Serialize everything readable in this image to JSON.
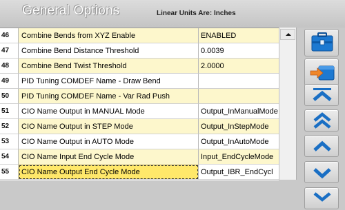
{
  "header": {
    "title": "General Options",
    "units_label": "Linear Units Are: Inches"
  },
  "rows": [
    {
      "num": "46",
      "name": "Combine Bends from XYZ Enable",
      "value": "ENABLED"
    },
    {
      "num": "47",
      "name": "Combine Bend Distance Threshold",
      "value": "0.0039"
    },
    {
      "num": "48",
      "name": "Combine Bend Twist Threshold",
      "value": "2.0000"
    },
    {
      "num": "49",
      "name": "PID Tuning COMDEF Name - Draw Bend",
      "value": ""
    },
    {
      "num": "50",
      "name": "PID Tuning COMDEF Name - Var Rad Push",
      "value": ""
    },
    {
      "num": "51",
      "name": "CIO Name Output in MANUAL Mode",
      "value": "Output_InManualMode"
    },
    {
      "num": "52",
      "name": "CIO Name Output in STEP Mode",
      "value": "Output_InStepMode"
    },
    {
      "num": "53",
      "name": "CIO Name Output in AUTO Mode",
      "value": "Output_InAutoMode"
    },
    {
      "num": "54",
      "name": "CIO Name Input End Cycle Mode",
      "value": "Input_EndCycleMode"
    },
    {
      "num": "55",
      "name": "CIO Name Output End Cycle Mode",
      "value": "Output_IBR_EndCycl"
    }
  ],
  "selected_row": "55",
  "sidebar": {
    "buttons": [
      {
        "icon": "toolbox-icon"
      },
      {
        "icon": "import-arrow-icon"
      },
      {
        "icon": "scroll-top-icon"
      },
      {
        "icon": "page-up-icon"
      },
      {
        "icon": "line-up-icon"
      },
      {
        "icon": "line-down-icon"
      }
    ]
  },
  "colors": {
    "row_yellow": "#fdf7cc",
    "row_selected": "#ffe86a",
    "icon_blue": "#1a6fc4"
  }
}
